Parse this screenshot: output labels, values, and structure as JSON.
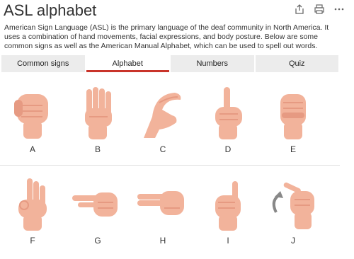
{
  "page": {
    "title": "ASL alphabet",
    "description": "American Sign Language (ASL) is the primary language of the deaf community in North America. It uses a combination of hand movements, facial expressions, and body posture. Below are some common signs as well as the American Manual Alphabet, which can be used to spell out words."
  },
  "toolbar": {
    "icons": [
      "share-icon",
      "print-icon",
      "more-icon"
    ]
  },
  "tabs": [
    {
      "label": "Common signs",
      "active": false
    },
    {
      "label": "Alphabet",
      "active": true
    },
    {
      "label": "Numbers",
      "active": false
    },
    {
      "label": "Quiz",
      "active": false
    }
  ],
  "letters": {
    "row1": [
      "A",
      "B",
      "C",
      "D",
      "E"
    ],
    "row2": [
      "F",
      "G",
      "H",
      "I",
      "J"
    ]
  },
  "colors": {
    "skin": "#f2b39b",
    "skin_shade": "#e69a82",
    "accent": "#c9342a",
    "tab_bg": "#ececec"
  }
}
